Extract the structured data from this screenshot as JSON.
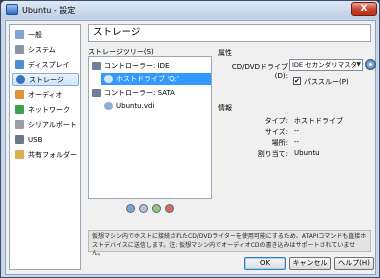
{
  "window": {
    "title": "Ubuntu - 設定",
    "close_label": "X"
  },
  "sidebar": {
    "items": [
      {
        "label": "一般",
        "color": "#7fa5d1"
      },
      {
        "label": "システム",
        "color": "#8a96a8"
      },
      {
        "label": "ディスプレイ",
        "color": "#4f8fd0"
      },
      {
        "label": "ストレージ",
        "color": "#3a73b8"
      },
      {
        "label": "オーディオ",
        "color": "#e0903a"
      },
      {
        "label": "ネットワーク",
        "color": "#3d9e4b"
      },
      {
        "label": "シリアルポート",
        "color": "#9aa0a8"
      },
      {
        "label": "USB",
        "color": "#6d7886"
      },
      {
        "label": "共有フォルダー",
        "color": "#d9b049"
      }
    ],
    "selected_index": 3
  },
  "page_title": "ストレージ",
  "storage_tree": {
    "label": "ストレージツリー(S)",
    "controller_ide": "コントローラー: IDE",
    "ide_drive": "ホストドライブ 'Q:'",
    "controller_sata": "コントローラー: SATA",
    "sata_disk": "Ubuntu.vdi"
  },
  "attributes": {
    "heading": "属性",
    "cd_drive_label": "CD/DVDドライブ(D):",
    "cd_drive_value": "IDE セカンダリマスタ",
    "passthrough_label": "パススルー(P)",
    "passthrough_checked": true
  },
  "info": {
    "heading": "情報",
    "type_label": "タイプ:",
    "type_value": "ホストドライブ",
    "size_label": "サイズ:",
    "size_value": "--",
    "location_label": "場所:",
    "location_value": "--",
    "attached_label": "割り当て:",
    "attached_value": "Ubuntu"
  },
  "description": "仮想マシン内でホストに接続されたCD/DVDライターを使用可能にするため、ATAPIコマンドも直接ホストデバイスに送信します。注: 仮想マシン内でオーディオCDの書き込みはサポートされていません。",
  "buttons": {
    "ok": "OK",
    "cancel": "キャンセル",
    "help": "ヘルプ(H)"
  }
}
